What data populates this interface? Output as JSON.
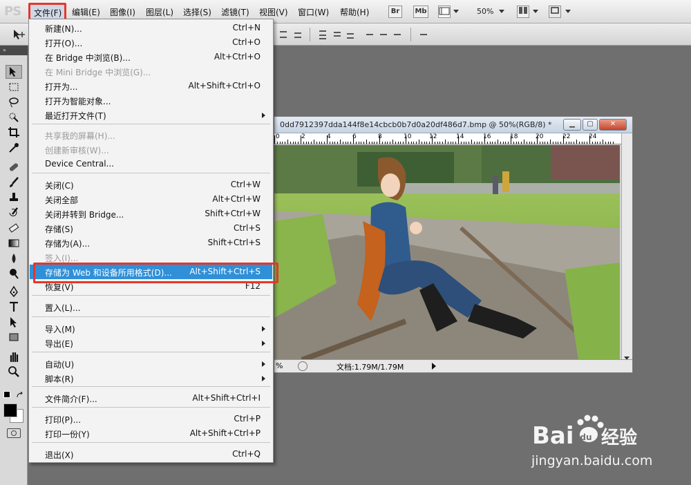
{
  "app": {
    "logo": "PS"
  },
  "menubar": {
    "items": [
      "文件(F)",
      "编辑(E)",
      "图像(I)",
      "图层(L)",
      "选择(S)",
      "滤镜(T)",
      "视图(V)",
      "窗口(W)",
      "帮助(H)"
    ],
    "bridge_btn": "Br",
    "minibridge_btn": "Mb",
    "zoom": "50%"
  },
  "file_menu": {
    "items": [
      {
        "label": "新建(N)...",
        "shortcut": "Ctrl+N"
      },
      {
        "label": "打开(O)...",
        "shortcut": "Ctrl+O"
      },
      {
        "label": "在 Bridge 中浏览(B)...",
        "shortcut": "Alt+Ctrl+O"
      },
      {
        "label": "在 Mini Bridge 中浏览(G)...",
        "shortcut": "",
        "disabled": true
      },
      {
        "label": "打开为...",
        "shortcut": "Alt+Shift+Ctrl+O"
      },
      {
        "label": "打开为智能对象...",
        "shortcut": ""
      },
      {
        "label": "最近打开文件(T)",
        "shortcut": "",
        "submenu": true
      },
      {
        "label": "共享我的屏幕(H)...",
        "shortcut": "",
        "disabled": true
      },
      {
        "label": "创建新审核(W)...",
        "shortcut": "",
        "disabled": true
      },
      {
        "label": "Device Central...",
        "shortcut": ""
      },
      {
        "label": "关闭(C)",
        "shortcut": "Ctrl+W"
      },
      {
        "label": "关闭全部",
        "shortcut": "Alt+Ctrl+W"
      },
      {
        "label": "关闭并转到 Bridge...",
        "shortcut": "Shift+Ctrl+W"
      },
      {
        "label": "存储(S)",
        "shortcut": "Ctrl+S"
      },
      {
        "label": "存储为(A)...",
        "shortcut": "Shift+Ctrl+S"
      },
      {
        "label": "签入(I)...",
        "shortcut": "",
        "disabled": true
      },
      {
        "label": "存储为 Web 和设备所用格式(D)...",
        "shortcut": "Alt+Shift+Ctrl+S",
        "highlighted": true
      },
      {
        "label": "恢复(V)",
        "shortcut": "F12"
      },
      {
        "label": "置入(L)...",
        "shortcut": ""
      },
      {
        "label": "导入(M)",
        "shortcut": "",
        "submenu": true
      },
      {
        "label": "导出(E)",
        "shortcut": "",
        "submenu": true
      },
      {
        "label": "自动(U)",
        "shortcut": "",
        "submenu": true
      },
      {
        "label": "脚本(R)",
        "shortcut": "",
        "submenu": true
      },
      {
        "label": "文件简介(F)...",
        "shortcut": "Alt+Shift+Ctrl+I"
      },
      {
        "label": "打印(P)...",
        "shortcut": "Ctrl+P"
      },
      {
        "label": "打印一份(Y)",
        "shortcut": "Alt+Shift+Ctrl+P"
      },
      {
        "label": "退出(X)",
        "shortcut": "Ctrl+Q"
      }
    ]
  },
  "document": {
    "title": "0dd7912397dda144f8e14cbcb0b7d0a20df486d7.bmp @ 50%(RGB/8) *",
    "ruler_labels": [
      "0",
      "2",
      "4",
      "6",
      "8",
      "10",
      "12",
      "14",
      "16",
      "18",
      "20",
      "22",
      "24"
    ],
    "status_zoom": "%",
    "status_doc": "文档:1.79M/1.79M"
  },
  "watermark": {
    "site": "jingyan.baidu.com"
  },
  "colors": {
    "highlight": "#2f8fd8",
    "red_box": "#e8352a"
  }
}
